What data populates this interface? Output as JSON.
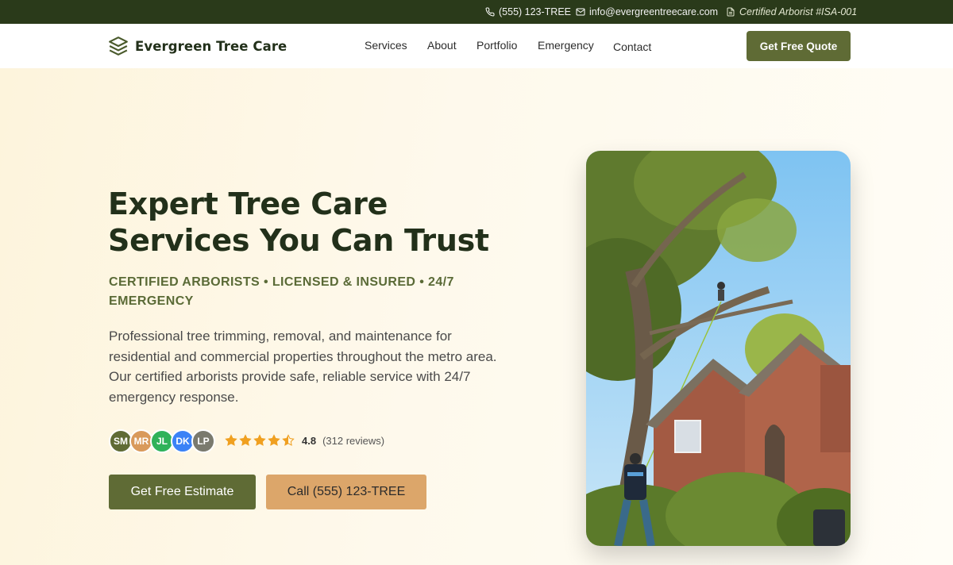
{
  "topbar": {
    "phone": "(555) 123-TREE",
    "email": "info@evergreentreecare.com",
    "certification": "Certified Arborist #ISA-001"
  },
  "nav": {
    "brand": "Evergreen Tree Care",
    "links": [
      "Services",
      "About",
      "Portfolio",
      "Emergency",
      "Contact"
    ],
    "cta": "Get Free Quote"
  },
  "hero": {
    "title_line1": "Expert Tree Care",
    "title_line2": "Services You Can Trust",
    "subtitle": "CERTIFIED ARBORISTS • LICENSED & INSURED • 24/7 EMERGENCY",
    "description": "Professional tree trimming, removal, and maintenance for residential and commercial properties throughout the metro area. Our certified arborists provide safe, reliable service with 24/7 emergency response.",
    "avatars": [
      {
        "initials": "SM",
        "color": "#5f6b35"
      },
      {
        "initials": "MR",
        "color": "#d99a5b"
      },
      {
        "initials": "JL",
        "color": "#2fb25a"
      },
      {
        "initials": "DK",
        "color": "#3b82f6"
      },
      {
        "initials": "LP",
        "color": "#7a7a6e"
      }
    ],
    "rating": {
      "score": "4.8",
      "stars": 4.5,
      "reviews": "(312 reviews)"
    },
    "primary_cta": "Get Free Estimate",
    "secondary_cta": "Call (555) 123-TREE"
  },
  "colors": {
    "dark_green": "#2a3a1a",
    "olive": "#5f6b35",
    "tan": "#dca66a",
    "star": "#f0a020"
  }
}
